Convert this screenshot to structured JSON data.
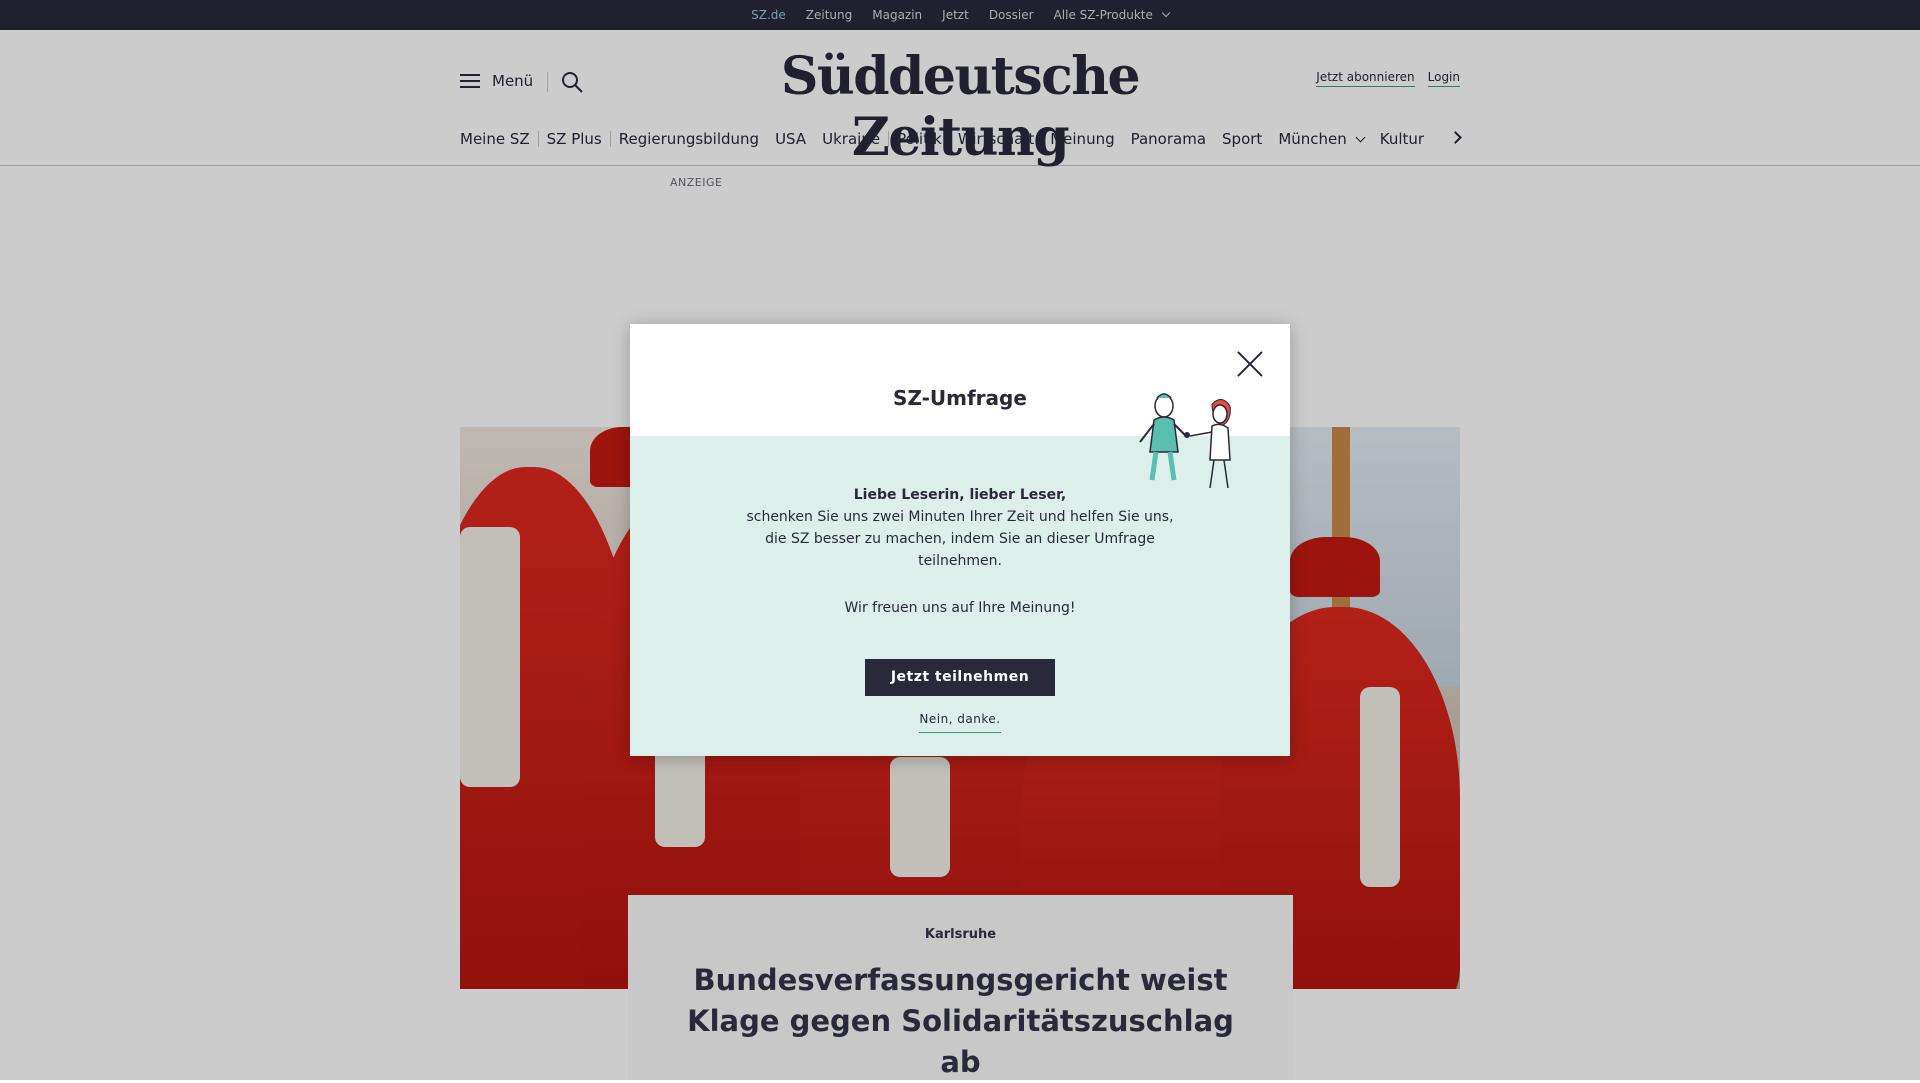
{
  "topbar": {
    "items": [
      "SZ.de",
      "Zeitung",
      "Magazin",
      "Jetzt",
      "Dossier",
      "Alle SZ-Produkte"
    ],
    "active_index": 0,
    "active_color": "#8fc9e6"
  },
  "header": {
    "menu_label": "Menü",
    "logo": "Süddeutsche Zeitung",
    "subscribe_label": "Jetzt abonnieren",
    "login_label": "Login"
  },
  "nav": {
    "items": [
      "Meine SZ",
      "SZ Plus",
      "Regierungsbildung",
      "USA",
      "Ukraine",
      "Politik",
      "Wirtschaft",
      "Meinung",
      "Panorama",
      "Sport",
      "München",
      "Kultur"
    ]
  },
  "ad_label": "ANZEIGE",
  "modal": {
    "title": "SZ-Umfrage",
    "greeting": "Liebe Leserin, lieber Leser,",
    "text": "schenken Sie uns zwei Minuten Ihrer Zeit und helfen Sie uns, die SZ besser zu machen, indem Sie an dieser Umfrage teilnehmen.",
    "thanks": "Wir freuen uns auf Ihre Meinung!",
    "cta_label": "Jetzt teilnehmen",
    "decline_label": "Nein, danke.",
    "body_color": "#dcefeb",
    "cta_color": "#29293a"
  },
  "article": {
    "kicker": "Karlsruhe",
    "headline": "Bundesverfassungsgericht weist Klage gegen Solidaritätszuschlag ab"
  },
  "colors": {
    "brand_dark": "#29293a",
    "accent_underline": "#3d9b7a"
  }
}
